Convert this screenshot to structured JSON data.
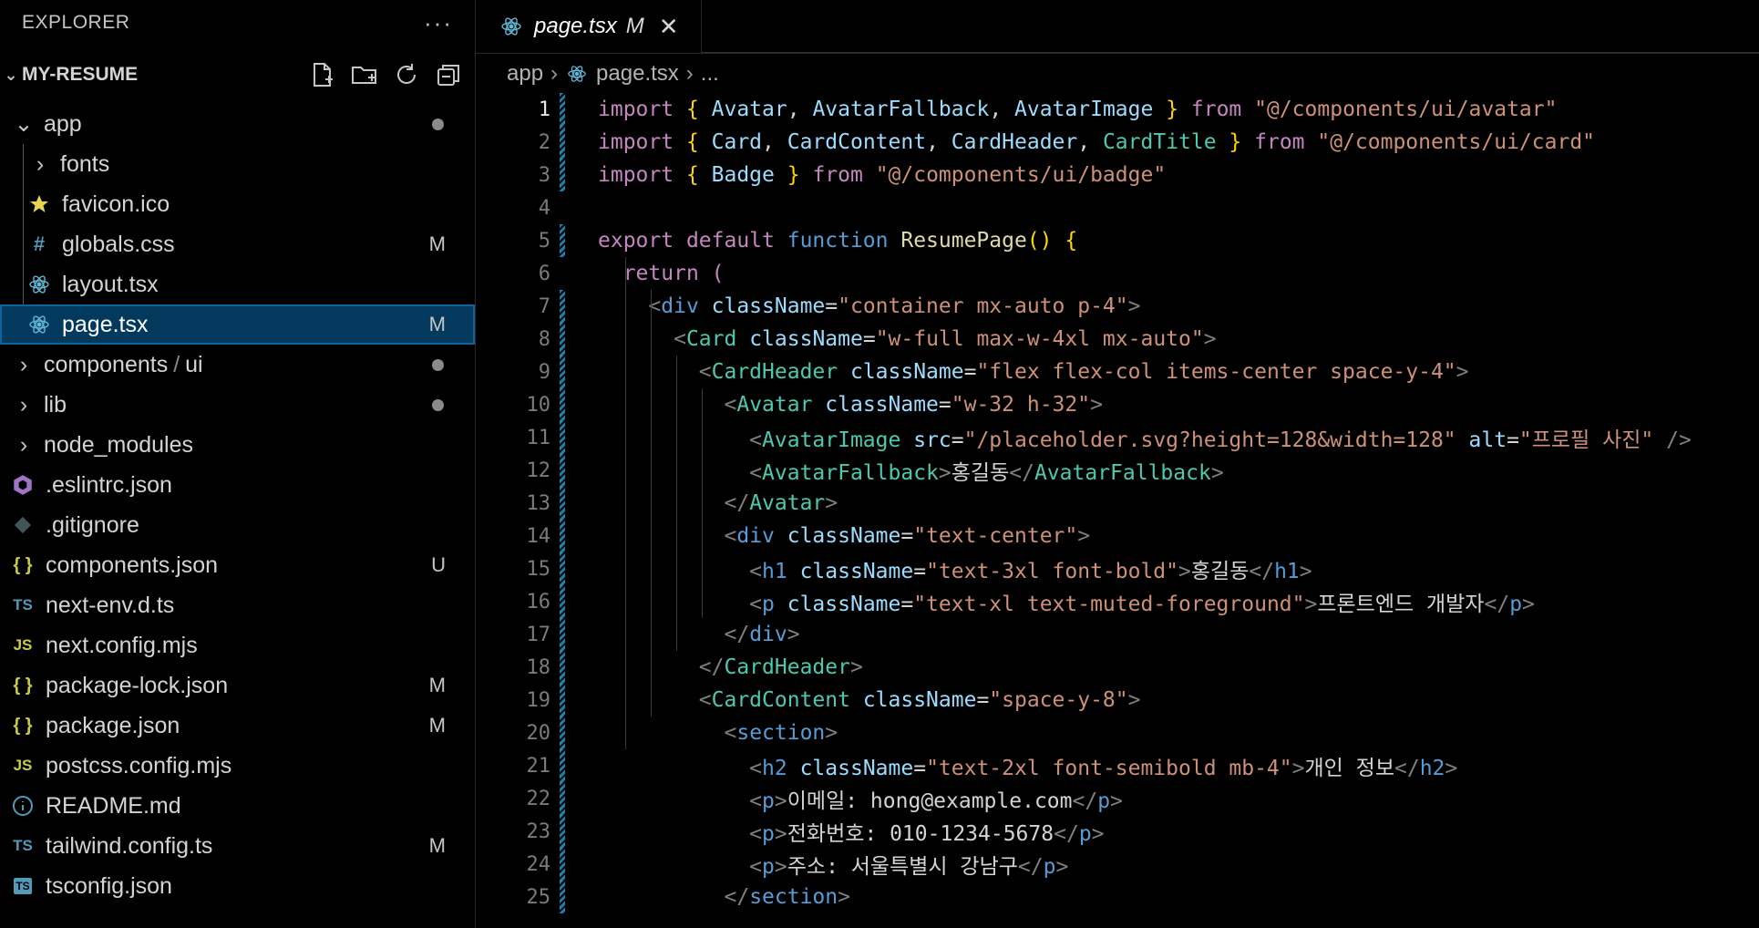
{
  "explorer": {
    "title": "EXPLORER",
    "project": "MY-RESUME",
    "items": [
      {
        "label": "app",
        "kind": "folder-open",
        "status": "dot"
      },
      {
        "label": "fonts",
        "kind": "folder",
        "status": ""
      },
      {
        "label": "favicon.ico",
        "kind": "star",
        "status": ""
      },
      {
        "label": "globals.css",
        "kind": "css",
        "status": "M"
      },
      {
        "label": "layout.tsx",
        "kind": "react",
        "status": ""
      },
      {
        "label": "page.tsx",
        "kind": "react",
        "status": "M"
      },
      {
        "label": "components",
        "sub": "ui",
        "kind": "folder",
        "status": "dot"
      },
      {
        "label": "lib",
        "kind": "folder",
        "status": "dot"
      },
      {
        "label": "node_modules",
        "kind": "folder",
        "status": ""
      },
      {
        "label": ".eslintrc.json",
        "kind": "eslint",
        "status": ""
      },
      {
        "label": ".gitignore",
        "kind": "git",
        "status": ""
      },
      {
        "label": "components.json",
        "kind": "json",
        "status": "U"
      },
      {
        "label": "next-env.d.ts",
        "kind": "ts",
        "status": ""
      },
      {
        "label": "next.config.mjs",
        "kind": "js",
        "status": ""
      },
      {
        "label": "package-lock.json",
        "kind": "json",
        "status": "M"
      },
      {
        "label": "package.json",
        "kind": "json",
        "status": "M"
      },
      {
        "label": "postcss.config.mjs",
        "kind": "js",
        "status": ""
      },
      {
        "label": "README.md",
        "kind": "info",
        "status": ""
      },
      {
        "label": "tailwind.config.ts",
        "kind": "ts",
        "status": "M"
      },
      {
        "label": "tsconfig.json",
        "kind": "tsconfig",
        "status": ""
      }
    ]
  },
  "tab": {
    "label": "page.tsx",
    "status": "M",
    "close": "✕"
  },
  "breadcrumb": {
    "folder": "app",
    "file": "page.tsx",
    "more": "..."
  },
  "code": {
    "line_numbers": [
      "1",
      "2",
      "3",
      "4",
      "5",
      "6",
      "7",
      "8",
      "9",
      "10",
      "11",
      "12",
      "13",
      "14",
      "15",
      "16",
      "17",
      "18",
      "19",
      "20",
      "21",
      "22",
      "23",
      "24",
      "25"
    ],
    "lines": [
      [
        [
          "k",
          "import "
        ],
        [
          "y",
          "{ "
        ],
        [
          "a",
          "Avatar"
        ],
        [
          "w",
          ", "
        ],
        [
          "a",
          "AvatarFallback"
        ],
        [
          "w",
          ", "
        ],
        [
          "a",
          "AvatarImage"
        ],
        [
          "y",
          " }"
        ],
        [
          "k",
          " from "
        ],
        [
          "s",
          "\"@/components/ui/avatar\""
        ]
      ],
      [
        [
          "k",
          "import "
        ],
        [
          "y",
          "{ "
        ],
        [
          "a",
          "Card"
        ],
        [
          "w",
          ", "
        ],
        [
          "a",
          "CardContent"
        ],
        [
          "w",
          ", "
        ],
        [
          "a",
          "CardHeader"
        ],
        [
          "w",
          ", "
        ],
        [
          "t",
          "CardTitle"
        ],
        [
          "y",
          " }"
        ],
        [
          "k",
          " from "
        ],
        [
          "s",
          "\"@/components/ui/card\""
        ]
      ],
      [
        [
          "k",
          "import "
        ],
        [
          "y",
          "{ "
        ],
        [
          "a",
          "Badge"
        ],
        [
          "y",
          " }"
        ],
        [
          "k",
          " from "
        ],
        [
          "s",
          "\"@/components/ui/badge\""
        ]
      ],
      [],
      [
        [
          "k",
          "export "
        ],
        [
          "k",
          "default "
        ],
        [
          "v",
          "function "
        ],
        [
          "f",
          "ResumePage"
        ],
        [
          "y",
          "() {"
        ]
      ],
      [
        [
          "w",
          "  "
        ],
        [
          "k",
          "return "
        ],
        [
          "k",
          "("
        ]
      ],
      [
        [
          "w",
          "    "
        ],
        [
          "p",
          "<"
        ],
        [
          "v",
          "div "
        ],
        [
          "a",
          "className"
        ],
        [
          "w",
          "="
        ],
        [
          "s",
          "\"container mx-auto p-4\""
        ],
        [
          "p",
          ">"
        ]
      ],
      [
        [
          "w",
          "      "
        ],
        [
          "p",
          "<"
        ],
        [
          "t",
          "Card "
        ],
        [
          "a",
          "className"
        ],
        [
          "w",
          "="
        ],
        [
          "s",
          "\"w-full max-w-4xl mx-auto\""
        ],
        [
          "p",
          ">"
        ]
      ],
      [
        [
          "w",
          "        "
        ],
        [
          "p",
          "<"
        ],
        [
          "t",
          "CardHeader "
        ],
        [
          "a",
          "className"
        ],
        [
          "w",
          "="
        ],
        [
          "s",
          "\"flex flex-col items-center space-y-4\""
        ],
        [
          "p",
          ">"
        ]
      ],
      [
        [
          "w",
          "          "
        ],
        [
          "p",
          "<"
        ],
        [
          "t",
          "Avatar "
        ],
        [
          "a",
          "className"
        ],
        [
          "w",
          "="
        ],
        [
          "s",
          "\"w-32 h-32\""
        ],
        [
          "p",
          ">"
        ]
      ],
      [
        [
          "w",
          "            "
        ],
        [
          "p",
          "<"
        ],
        [
          "t",
          "AvatarImage "
        ],
        [
          "a",
          "src"
        ],
        [
          "w",
          "="
        ],
        [
          "s",
          "\"/placeholder.svg?height=128&width=128\""
        ],
        [
          "w",
          " "
        ],
        [
          "a",
          "alt"
        ],
        [
          "w",
          "="
        ],
        [
          "s",
          "\"프로필 사진\""
        ],
        [
          "p",
          " />"
        ]
      ],
      [
        [
          "w",
          "            "
        ],
        [
          "p",
          "<"
        ],
        [
          "t",
          "AvatarFallback"
        ],
        [
          "p",
          ">"
        ],
        [
          "w",
          "홍길동"
        ],
        [
          "p",
          "</"
        ],
        [
          "t",
          "AvatarFallback"
        ],
        [
          "p",
          ">"
        ]
      ],
      [
        [
          "w",
          "          "
        ],
        [
          "p",
          "</"
        ],
        [
          "t",
          "Avatar"
        ],
        [
          "p",
          ">"
        ]
      ],
      [
        [
          "w",
          "          "
        ],
        [
          "p",
          "<"
        ],
        [
          "v",
          "div "
        ],
        [
          "a",
          "className"
        ],
        [
          "w",
          "="
        ],
        [
          "s",
          "\"text-center\""
        ],
        [
          "p",
          ">"
        ]
      ],
      [
        [
          "w",
          "            "
        ],
        [
          "p",
          "<"
        ],
        [
          "v",
          "h1 "
        ],
        [
          "a",
          "className"
        ],
        [
          "w",
          "="
        ],
        [
          "s",
          "\"text-3xl font-bold\""
        ],
        [
          "p",
          ">"
        ],
        [
          "w",
          "홍길동"
        ],
        [
          "p",
          "</"
        ],
        [
          "v",
          "h1"
        ],
        [
          "p",
          ">"
        ]
      ],
      [
        [
          "w",
          "            "
        ],
        [
          "p",
          "<"
        ],
        [
          "v",
          "p "
        ],
        [
          "a",
          "className"
        ],
        [
          "w",
          "="
        ],
        [
          "s",
          "\"text-xl text-muted-foreground\""
        ],
        [
          "p",
          ">"
        ],
        [
          "w",
          "프론트엔드 개발자"
        ],
        [
          "p",
          "</"
        ],
        [
          "v",
          "p"
        ],
        [
          "p",
          ">"
        ]
      ],
      [
        [
          "w",
          "          "
        ],
        [
          "p",
          "</"
        ],
        [
          "v",
          "div"
        ],
        [
          "p",
          ">"
        ]
      ],
      [
        [
          "w",
          "        "
        ],
        [
          "p",
          "</"
        ],
        [
          "t",
          "CardHeader"
        ],
        [
          "p",
          ">"
        ]
      ],
      [
        [
          "w",
          "        "
        ],
        [
          "p",
          "<"
        ],
        [
          "t",
          "CardContent "
        ],
        [
          "a",
          "className"
        ],
        [
          "w",
          "="
        ],
        [
          "s",
          "\"space-y-8\""
        ],
        [
          "p",
          ">"
        ]
      ],
      [
        [
          "w",
          "          "
        ],
        [
          "p",
          "<"
        ],
        [
          "v",
          "section"
        ],
        [
          "p",
          ">"
        ]
      ],
      [
        [
          "w",
          "            "
        ],
        [
          "p",
          "<"
        ],
        [
          "v",
          "h2 "
        ],
        [
          "a",
          "className"
        ],
        [
          "w",
          "="
        ],
        [
          "s",
          "\"text-2xl font-semibold mb-4\""
        ],
        [
          "p",
          ">"
        ],
        [
          "w",
          "개인 정보"
        ],
        [
          "p",
          "</"
        ],
        [
          "v",
          "h2"
        ],
        [
          "p",
          ">"
        ]
      ],
      [
        [
          "w",
          "            "
        ],
        [
          "p",
          "<"
        ],
        [
          "v",
          "p"
        ],
        [
          "p",
          ">"
        ],
        [
          "w",
          "이메일: hong@example.com"
        ],
        [
          "p",
          "</"
        ],
        [
          "v",
          "p"
        ],
        [
          "p",
          ">"
        ]
      ],
      [
        [
          "w",
          "            "
        ],
        [
          "p",
          "<"
        ],
        [
          "v",
          "p"
        ],
        [
          "p",
          ">"
        ],
        [
          "w",
          "전화번호: 010-1234-5678"
        ],
        [
          "p",
          "</"
        ],
        [
          "v",
          "p"
        ],
        [
          "p",
          ">"
        ]
      ],
      [
        [
          "w",
          "            "
        ],
        [
          "p",
          "<"
        ],
        [
          "v",
          "p"
        ],
        [
          "p",
          ">"
        ],
        [
          "w",
          "주소: 서울특별시 강남구"
        ],
        [
          "p",
          "</"
        ],
        [
          "v",
          "p"
        ],
        [
          "p",
          ">"
        ]
      ],
      [
        [
          "w",
          "          "
        ],
        [
          "p",
          "</"
        ],
        [
          "v",
          "section"
        ],
        [
          "p",
          ">"
        ]
      ]
    ]
  }
}
